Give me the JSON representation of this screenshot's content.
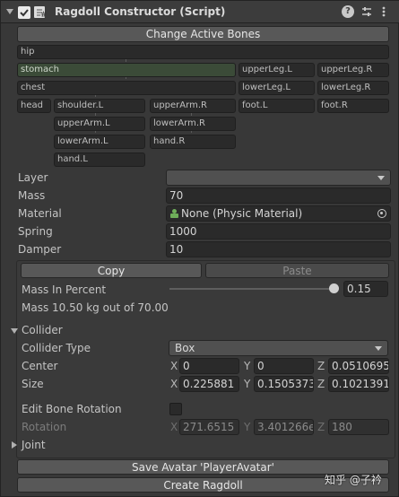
{
  "header": {
    "title": "Ragdoll Constructor (Script)",
    "help_icon": "question-icon",
    "settings_icon": "sliders-icon",
    "menu_icon": "kebab-menu-icon"
  },
  "bones": {
    "change_label": "Change Active Bones",
    "items": {
      "hip": "hip",
      "stomach": "stomach",
      "upperLegL": "upperLeg.L",
      "upperLegR": "upperLeg.R",
      "chest": "chest",
      "lowerLegL": "lowerLeg.L",
      "lowerLegR": "lowerLeg.R",
      "head": "head",
      "shoulderL": "shoulder.L",
      "upperArmR": "upperArm.R",
      "footL": "foot.L",
      "footR": "foot.R",
      "upperArmL": "upperArm.L",
      "lowerArmR": "lowerArm.R",
      "lowerArmL": "lowerArm.L",
      "handR": "hand.R",
      "handL": "hand.L"
    }
  },
  "props": {
    "layer_label": "Layer",
    "layer_value": "",
    "mass_label": "Mass",
    "mass_value": "70",
    "material_label": "Material",
    "material_value": "None (Physic Material)",
    "spring_label": "Spring",
    "spring_value": "1000",
    "damper_label": "Damper",
    "damper_value": "10"
  },
  "clip": {
    "copy_label": "Copy",
    "paste_label": "Paste"
  },
  "mass_percent": {
    "label": "Mass In Percent",
    "value": "0.15",
    "fraction": 1.0,
    "summary": "Mass 10.50 kg out of 70.00"
  },
  "collider": {
    "header": "Collider",
    "type_label": "Collider Type",
    "type_value": "Box",
    "center_label": "Center",
    "center": {
      "x": "0",
      "y": "0",
      "z": "0.0510695"
    },
    "size_label": "Size",
    "size": {
      "x": "0.225881",
      "y": "0.1505373",
      "z": "0.1021391"
    }
  },
  "rotation": {
    "edit_label": "Edit Bone Rotation",
    "label": "Rotation",
    "x": "271.6515",
    "y": "3.401266e",
    "z": "180"
  },
  "joint": {
    "header": "Joint"
  },
  "footer": {
    "save_label": "Save Avatar 'PlayerAvatar'",
    "create_label": "Create Ragdoll",
    "watermark": "知乎 @子衿"
  },
  "axis_letters": {
    "x": "X",
    "y": "Y",
    "z": "Z"
  }
}
